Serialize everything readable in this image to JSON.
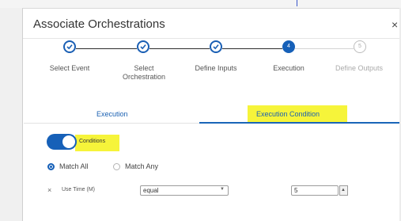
{
  "dialog": {
    "title": "Associate Orchestrations",
    "close_glyph": "×"
  },
  "wizard": {
    "steps": [
      {
        "label": "Select Event",
        "state": "completed"
      },
      {
        "label": "Select Orchestration",
        "state": "completed"
      },
      {
        "label": "Define Inputs",
        "state": "completed"
      },
      {
        "label": "Execution",
        "state": "current",
        "number": "4"
      },
      {
        "label": "Define Outputs",
        "state": "pending",
        "number": "5"
      }
    ]
  },
  "tabs": {
    "items": [
      {
        "label": "Execution",
        "active": false
      },
      {
        "label": "Execution Condition",
        "active": true
      }
    ]
  },
  "condition": {
    "toggle_on": true,
    "label": "Conditions",
    "match": {
      "all_label": "Match All",
      "any_label": "Match Any",
      "selected": "all"
    },
    "rule": {
      "remove_glyph": "×",
      "field": "Use Time (M)",
      "operator": "equal",
      "value": "5"
    }
  },
  "colors": {
    "accent": "#1660b8",
    "highlight": "#f6f43a"
  }
}
